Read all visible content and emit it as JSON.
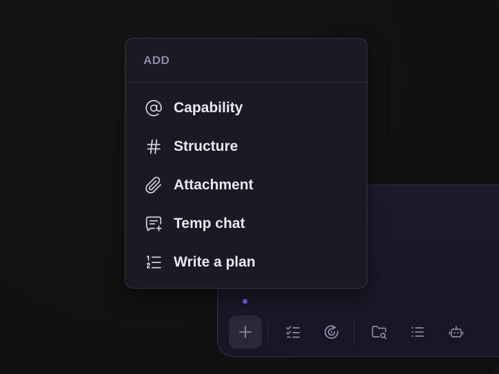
{
  "menu": {
    "header": "ADD",
    "items": [
      {
        "label": "Capability",
        "icon": "at-icon"
      },
      {
        "label": "Structure",
        "icon": "hash-icon"
      },
      {
        "label": "Attachment",
        "icon": "paperclip-icon"
      },
      {
        "label": "Temp chat",
        "icon": "chat-plus-icon"
      },
      {
        "label": "Write a plan",
        "icon": "numbered-list-icon"
      }
    ]
  },
  "toolbar": {
    "buttons": [
      {
        "icon": "plus-icon",
        "active": true
      },
      {
        "icon": "checklist-icon"
      },
      {
        "icon": "target-play-icon"
      },
      {
        "icon": "folder-search-icon"
      },
      {
        "icon": "list-icon"
      },
      {
        "icon": "robot-icon"
      }
    ]
  },
  "colors": {
    "background": "#121212",
    "menu_bg": "#1a1924",
    "accent_dot": "#7b61d9",
    "text": "#e9e8ef",
    "muted": "#8b89a7"
  }
}
